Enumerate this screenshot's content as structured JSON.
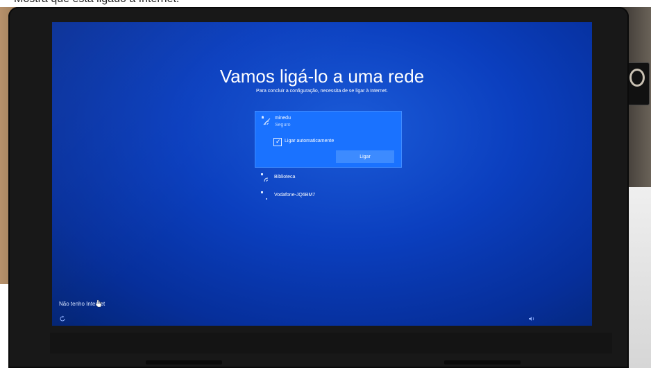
{
  "top_text": "Mostra que esta ligado à Internet.\"",
  "oobe": {
    "title": "Vamos ligá-lo a uma rede",
    "subtitle": "Para concluir a configuração, necessita de se ligar à Internet."
  },
  "networks": {
    "selected": {
      "ssid": "minedu",
      "status": "Seguro",
      "auto_connect_label": "Ligar automaticamente",
      "auto_connect_checked": true,
      "connect_label": "Ligar"
    },
    "others": [
      {
        "ssid": "Biblioteca"
      },
      {
        "ssid": "Vodafone-JQ6BM7"
      }
    ]
  },
  "footer": {
    "no_internet_label": "Não tenho Internet"
  },
  "icons": {
    "wifi": "wifi-lock-icon",
    "refresh": "ease-of-access-icon",
    "volume": "volume-icon",
    "cursor": "hand-cursor-icon",
    "checkmark": "checkmark-icon"
  },
  "colors": {
    "screen_blue": "#0b3fbf",
    "selected_network": "#1a72ff",
    "connect_button": "#3d8bff"
  }
}
